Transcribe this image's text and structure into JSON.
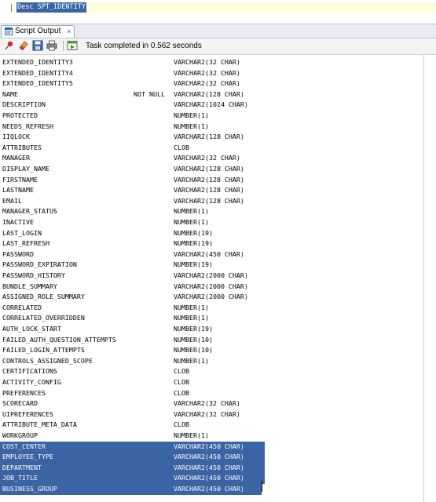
{
  "editor": {
    "query": "Desc SPT_IDENTITY"
  },
  "output_tab": {
    "label": "Script Output",
    "close": "×"
  },
  "toolbar": {
    "status": "Task completed in 0.562 seconds",
    "buttons": [
      "pin-icon",
      "eraser-icon",
      "save-icon",
      "print-icon",
      "export-icon"
    ]
  },
  "colors": {
    "selection": "#3a64a4",
    "current_line": "#fefcd9"
  },
  "rows": [
    {
      "name": "EXTENDED_IDENTITY3",
      "null": "",
      "type": "VARCHAR2(32 CHAR)"
    },
    {
      "name": "EXTENDED_IDENTITY4",
      "null": "",
      "type": "VARCHAR2(32 CHAR)"
    },
    {
      "name": "EXTENDED_IDENTITY5",
      "null": "",
      "type": "VARCHAR2(32 CHAR)"
    },
    {
      "name": "NAME",
      "null": "NOT NULL",
      "type": "VARCHAR2(128 CHAR)"
    },
    {
      "name": "DESCRIPTION",
      "null": "",
      "type": "VARCHAR2(1024 CHAR)"
    },
    {
      "name": "PROTECTED",
      "null": "",
      "type": "NUMBER(1)"
    },
    {
      "name": "NEEDS_REFRESH",
      "null": "",
      "type": "NUMBER(1)"
    },
    {
      "name": "IIQLOCK",
      "null": "",
      "type": "VARCHAR2(128 CHAR)"
    },
    {
      "name": "ATTRIBUTES",
      "null": "",
      "type": "CLOB"
    },
    {
      "name": "MANAGER",
      "null": "",
      "type": "VARCHAR2(32 CHAR)"
    },
    {
      "name": "DISPLAY_NAME",
      "null": "",
      "type": "VARCHAR2(128 CHAR)"
    },
    {
      "name": "FIRSTNAME",
      "null": "",
      "type": "VARCHAR2(128 CHAR)"
    },
    {
      "name": "LASTNAME",
      "null": "",
      "type": "VARCHAR2(128 CHAR)"
    },
    {
      "name": "EMAIL",
      "null": "",
      "type": "VARCHAR2(128 CHAR)"
    },
    {
      "name": "MANAGER_STATUS",
      "null": "",
      "type": "NUMBER(1)"
    },
    {
      "name": "INACTIVE",
      "null": "",
      "type": "NUMBER(1)"
    },
    {
      "name": "LAST_LOGIN",
      "null": "",
      "type": "NUMBER(19)"
    },
    {
      "name": "LAST_REFRESH",
      "null": "",
      "type": "NUMBER(19)"
    },
    {
      "name": "PASSWORD",
      "null": "",
      "type": "VARCHAR2(450 CHAR)"
    },
    {
      "name": "PASSWORD_EXPIRATION",
      "null": "",
      "type": "NUMBER(19)"
    },
    {
      "name": "PASSWORD_HISTORY",
      "null": "",
      "type": "VARCHAR2(2000 CHAR)"
    },
    {
      "name": "BUNDLE_SUMMARY",
      "null": "",
      "type": "VARCHAR2(2000 CHAR)"
    },
    {
      "name": "ASSIGNED_ROLE_SUMMARY",
      "null": "",
      "type": "VARCHAR2(2000 CHAR)"
    },
    {
      "name": "CORRELATED",
      "null": "",
      "type": "NUMBER(1)"
    },
    {
      "name": "CORRELATED_OVERRIDDEN",
      "null": "",
      "type": "NUMBER(1)"
    },
    {
      "name": "AUTH_LOCK_START",
      "null": "",
      "type": "NUMBER(19)"
    },
    {
      "name": "FAILED_AUTH_QUESTION_ATTEMPTS",
      "null": "",
      "type": "NUMBER(10)"
    },
    {
      "name": "FAILED_LOGIN_ATTEMPTS",
      "null": "",
      "type": "NUMBER(10)"
    },
    {
      "name": "CONTROLS_ASSIGNED_SCOPE",
      "null": "",
      "type": "NUMBER(1)"
    },
    {
      "name": "CERTIFICATIONS",
      "null": "",
      "type": "CLOB"
    },
    {
      "name": "ACTIVITY_CONFIG",
      "null": "",
      "type": "CLOB"
    },
    {
      "name": "PREFERENCES",
      "null": "",
      "type": "CLOB"
    },
    {
      "name": "SCORECARD",
      "null": "",
      "type": "VARCHAR2(32 CHAR)"
    },
    {
      "name": "UIPREFERENCES",
      "null": "",
      "type": "VARCHAR2(32 CHAR)"
    },
    {
      "name": "ATTRIBUTE_META_DATA",
      "null": "",
      "type": "CLOB"
    },
    {
      "name": "WORKGROUP",
      "null": "",
      "type": "NUMBER(1)"
    },
    {
      "name": "COST_CENTER",
      "null": "",
      "type": "VARCHAR2(450 CHAR)",
      "selected": true
    },
    {
      "name": "EMPLOYEE_TYPE",
      "null": "",
      "type": "VARCHAR2(450 CHAR)",
      "selected": true
    },
    {
      "name": "DEPARTMENT",
      "null": "",
      "type": "VARCHAR2(450 CHAR)",
      "selected": true
    },
    {
      "name": "JOB_TITLE",
      "null": "",
      "type": "VARCHAR2(450 CHAR)",
      "selected": true
    },
    {
      "name": "BUSINESS_GROUP",
      "null": "",
      "type": "VARCHAR2(450 CHAR)",
      "selected": true
    }
  ]
}
